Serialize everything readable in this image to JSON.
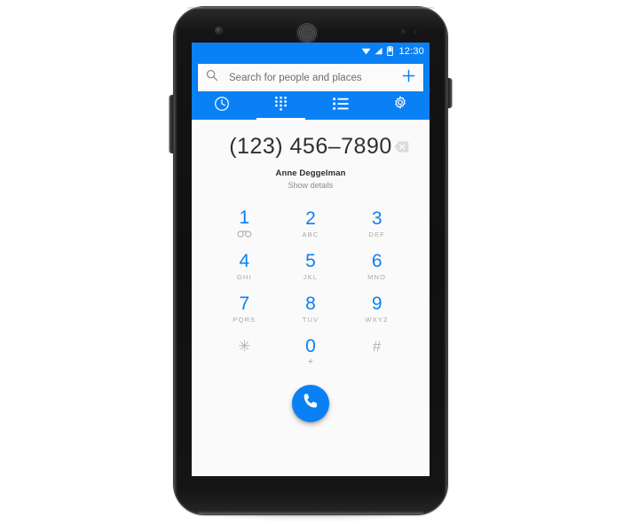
{
  "theme": {
    "brand_blue": "#0a80f5",
    "screen_bg": "#fafafa",
    "muted_gray": "#a8a8a8",
    "text_dark": "#303030",
    "device_black": "#101010"
  },
  "status_bar": {
    "time": "12:30",
    "icons": [
      "wifi-icon",
      "cellular-signal-icon",
      "battery-icon"
    ]
  },
  "search": {
    "placeholder": "Search for people and places",
    "search_icon": "search-icon",
    "add_icon": "plus-icon"
  },
  "tabs": [
    {
      "id": "recents",
      "icon": "clock-icon",
      "label": "Recents",
      "active": false
    },
    {
      "id": "dialpad",
      "icon": "dialpad-icon",
      "label": "Dialpad",
      "active": true
    },
    {
      "id": "contacts",
      "icon": "list-icon",
      "label": "Contacts",
      "active": false
    },
    {
      "id": "settings",
      "icon": "gear-icon",
      "label": "Settings",
      "active": false
    }
  ],
  "dialer": {
    "number": "(123) 456–7890",
    "contact_name": "Anne Deggelman",
    "show_details_label": "Show details",
    "clear_icon": "backspace-clear-icon",
    "call_icon": "phone-handset-icon"
  },
  "keypad": [
    {
      "digit": "1",
      "sub": "",
      "sub_icon": "voicemail-icon",
      "muted": false
    },
    {
      "digit": "2",
      "sub": "ABC",
      "sub_icon": "",
      "muted": false
    },
    {
      "digit": "3",
      "sub": "DEF",
      "sub_icon": "",
      "muted": false
    },
    {
      "digit": "4",
      "sub": "GHI",
      "sub_icon": "",
      "muted": false
    },
    {
      "digit": "5",
      "sub": "JKL",
      "sub_icon": "",
      "muted": false
    },
    {
      "digit": "6",
      "sub": "MNO",
      "sub_icon": "",
      "muted": false
    },
    {
      "digit": "7",
      "sub": "PQRS",
      "sub_icon": "",
      "muted": false
    },
    {
      "digit": "8",
      "sub": "TUV",
      "sub_icon": "",
      "muted": false
    },
    {
      "digit": "9",
      "sub": "WXYZ",
      "sub_icon": "",
      "muted": false
    },
    {
      "digit": "✳",
      "sub": "",
      "sub_icon": "",
      "muted": true
    },
    {
      "digit": "0",
      "sub": "+",
      "sub_icon": "",
      "muted": false
    },
    {
      "digit": "#",
      "sub": "",
      "sub_icon": "",
      "muted": true
    }
  ],
  "device": {
    "hardware": [
      "front-camera",
      "earpiece-speaker",
      "proximity-sensor",
      "volume-rocker-button",
      "power-button"
    ]
  }
}
